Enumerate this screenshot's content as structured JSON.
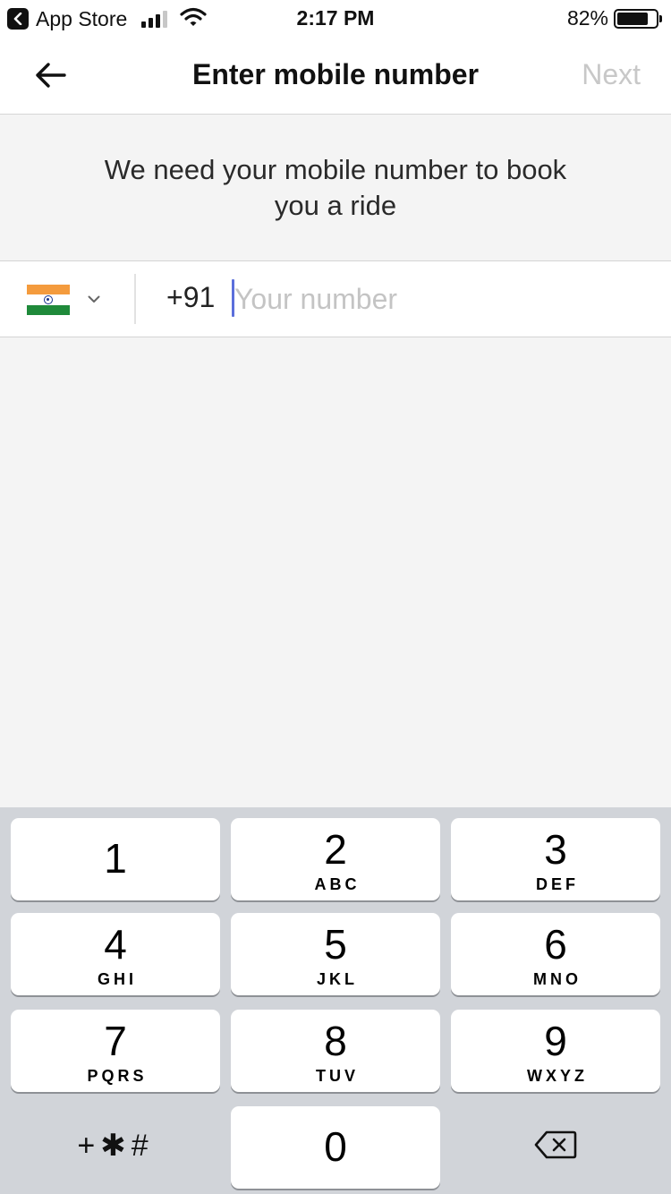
{
  "status_bar": {
    "back_app": "App Store",
    "time": "2:17 PM",
    "battery": "82%",
    "battery_level": 0.82,
    "signal_bars": 3
  },
  "nav": {
    "title": "Enter mobile number",
    "next_label": "Next"
  },
  "instructions": "We need your mobile number to book you a ride",
  "phone": {
    "dial_code": "+91",
    "placeholder": "Your number",
    "value": ""
  },
  "keypad": {
    "keys": [
      {
        "digit": "1",
        "letters": ""
      },
      {
        "digit": "2",
        "letters": "ABC"
      },
      {
        "digit": "3",
        "letters": "DEF"
      },
      {
        "digit": "4",
        "letters": "GHI"
      },
      {
        "digit": "5",
        "letters": "JKL"
      },
      {
        "digit": "6",
        "letters": "MNO"
      },
      {
        "digit": "7",
        "letters": "PQRS"
      },
      {
        "digit": "8",
        "letters": "TUV"
      },
      {
        "digit": "9",
        "letters": "WXYZ"
      },
      {
        "digit": "0",
        "letters": ""
      }
    ],
    "symbols_label": "+✱#",
    "delete_icon": "backspace-icon"
  },
  "colors": {
    "caret": "#5b6fdb",
    "next_disabled": "#c8c8c8",
    "keypad_bg": "#d1d4d9"
  }
}
